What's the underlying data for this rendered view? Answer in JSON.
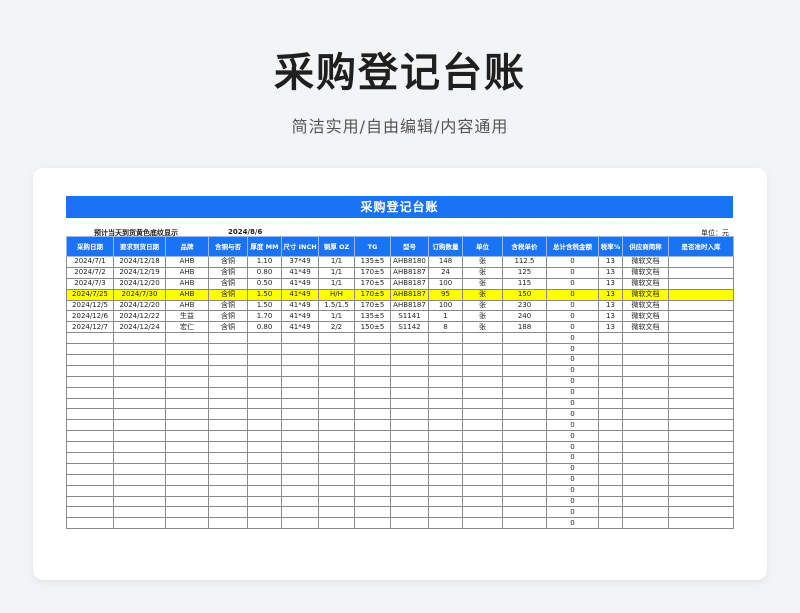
{
  "hero": {
    "title": "采购登记台账",
    "subtitle": "简洁实用/自由编辑/内容通用"
  },
  "sheet": {
    "title": "采购登记台账",
    "note": "预计当天到货黄色底纹显示",
    "date": "2024/8/6",
    "unit": "单位：元",
    "columns": [
      "采购日期",
      "要求到货日期",
      "品牌",
      "含铜与否",
      "厚度 MM",
      "尺寸 INCH",
      "铜厚 OZ",
      "TG",
      "型号",
      "订购数量",
      "单位",
      "含税单价",
      "总计含税金额",
      "税率%",
      "供应商简称",
      "是否准时入库"
    ],
    "rows": [
      [
        "2024/7/1",
        "2024/12/18",
        "AHB",
        "含铜",
        "1.10",
        "37*49",
        "1/1",
        "135±5",
        "AHB8180",
        "148",
        "张",
        "112.5",
        "0",
        "13",
        "微软文档",
        ""
      ],
      [
        "2024/7/2",
        "2024/12/19",
        "AHB",
        "含铜",
        "0.80",
        "41*49",
        "1/1",
        "170±5",
        "AHB8187",
        "24",
        "张",
        "125",
        "0",
        "13",
        "微软文档",
        ""
      ],
      [
        "2024/7/3",
        "2024/12/20",
        "AHB",
        "含铜",
        "0.50",
        "41*49",
        "1/1",
        "170±5",
        "AHB8187",
        "100",
        "张",
        "115",
        "0",
        "13",
        "微软文档",
        ""
      ],
      [
        "2024/7/25",
        "2024/7/30",
        "AHB",
        "含铜",
        "1.50",
        "41*49",
        "H/H",
        "170±5",
        "AHB8187",
        "95",
        "张",
        "150",
        "0",
        "13",
        "微软文档",
        ""
      ],
      [
        "2024/12/5",
        "2024/12/20",
        "AHB",
        "含铜",
        "1.50",
        "41*49",
        "1.5/1.5",
        "170±5",
        "AHB8187",
        "100",
        "张",
        "230",
        "0",
        "13",
        "微软文档",
        ""
      ],
      [
        "2024/12/6",
        "2024/12/22",
        "生益",
        "含铜",
        "1.70",
        "41*49",
        "1/1",
        "135±5",
        "S1141",
        "1",
        "张",
        "240",
        "0",
        "13",
        "微软文档",
        ""
      ],
      [
        "2024/12/7",
        "2024/12/24",
        "宏仁",
        "含铜",
        "0.80",
        "41*49",
        "2/2",
        "150±5",
        "S1142",
        "8",
        "张",
        "188",
        "0",
        "13",
        "微软文档",
        ""
      ]
    ],
    "highlight_row_index": 3,
    "empty_total_value": "0",
    "empty_row_count": 18,
    "colors": {
      "header_blue": "#1a73f5",
      "highlight": "#ffff00"
    }
  }
}
